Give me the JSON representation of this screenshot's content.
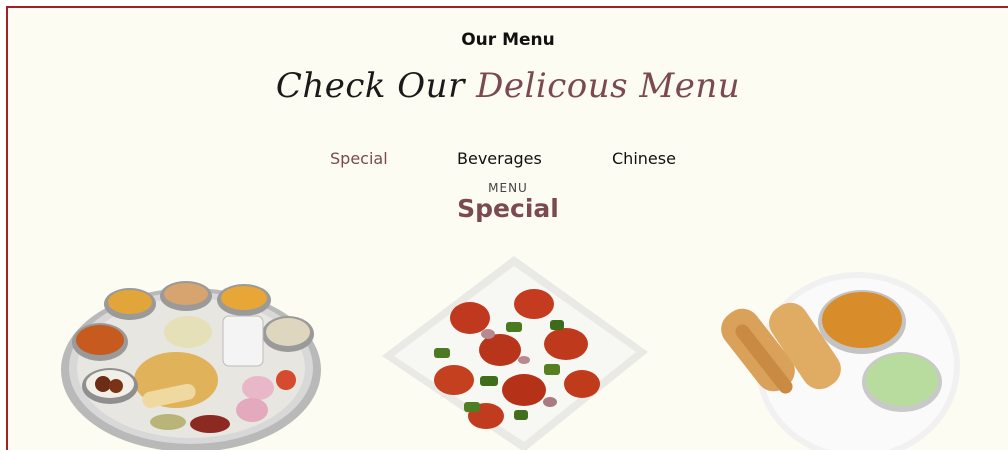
{
  "section": {
    "label": "Our Menu",
    "heading_plain": "Check Our",
    "heading_accent": "Delicous Menu"
  },
  "tabs": [
    {
      "label": "Special",
      "active": true
    },
    {
      "label": "Beverages",
      "active": false
    },
    {
      "label": "Chinese",
      "active": false
    }
  ],
  "menu": {
    "kicker": "MENU",
    "title": "Special"
  },
  "colors": {
    "accent": "#7b4a4e",
    "background": "#fdfcf2",
    "frame_border": "#a31f24"
  },
  "dishes": [
    {
      "image": "thali-plate-image"
    },
    {
      "image": "chilli-chicken-image"
    },
    {
      "image": "dosa-plate-image"
    }
  ]
}
